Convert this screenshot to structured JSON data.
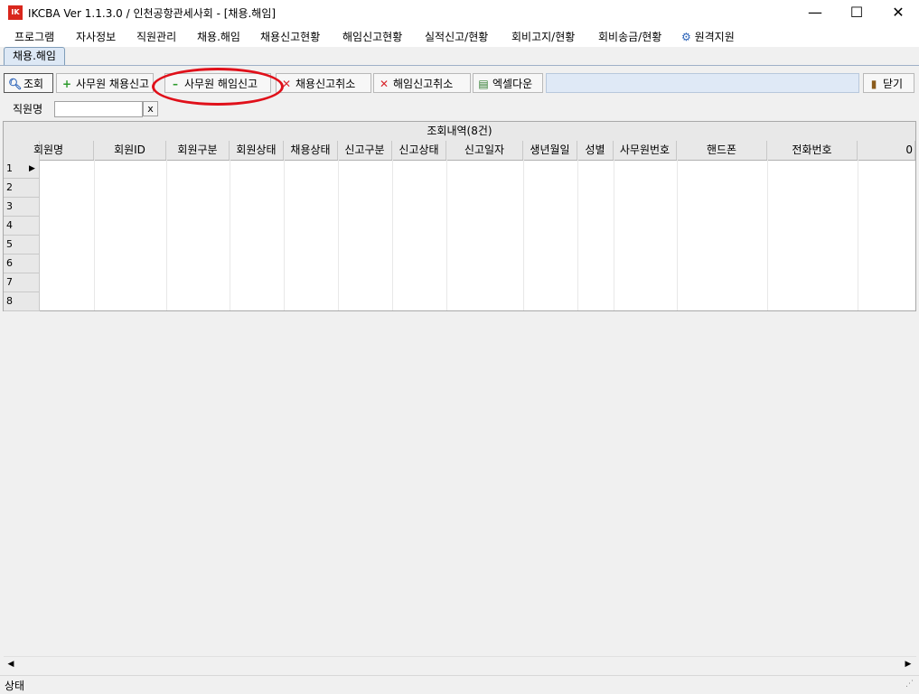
{
  "window": {
    "title": "IKCBA Ver 1.1.3.0 / 인천공항관세사회 - [채용.해임]",
    "logo_text": "IK",
    "minimize": "—",
    "maximize": "☐",
    "close": "✕"
  },
  "menu": [
    "프로그램",
    "자사정보",
    "직원관리",
    "채용.해임",
    "채용신고현황",
    "해임신고현황",
    "실적신고/현황",
    "회비고지/현황",
    "회비송금/현황",
    "원격지원"
  ],
  "tabs": [
    "채용.해임"
  ],
  "toolbar": {
    "search": "조회",
    "hire_report": "사무원 채용신고",
    "dismiss_report": "사무원 해임신고",
    "cancel_hire": "채용신고취소",
    "cancel_dismiss": "해임신고취소",
    "excel": "엑셀다운",
    "close": "닫기"
  },
  "filter": {
    "label": "직원명",
    "value": "",
    "clear": "x"
  },
  "grid": {
    "caption": "조회내역(8건)",
    "columns": [
      "회원명",
      "회원ID",
      "회원구분",
      "회원상태",
      "채용상태",
      "신고구분",
      "신고상태",
      "신고일자",
      "생년월일",
      "성별",
      "사무원번호",
      "핸드폰",
      "전화번호",
      "0"
    ],
    "row_numbers": [
      "1",
      "2",
      "3",
      "4",
      "5",
      "6",
      "7",
      "8"
    ],
    "current_row_marker": "▶"
  },
  "status": {
    "text": "상태"
  }
}
